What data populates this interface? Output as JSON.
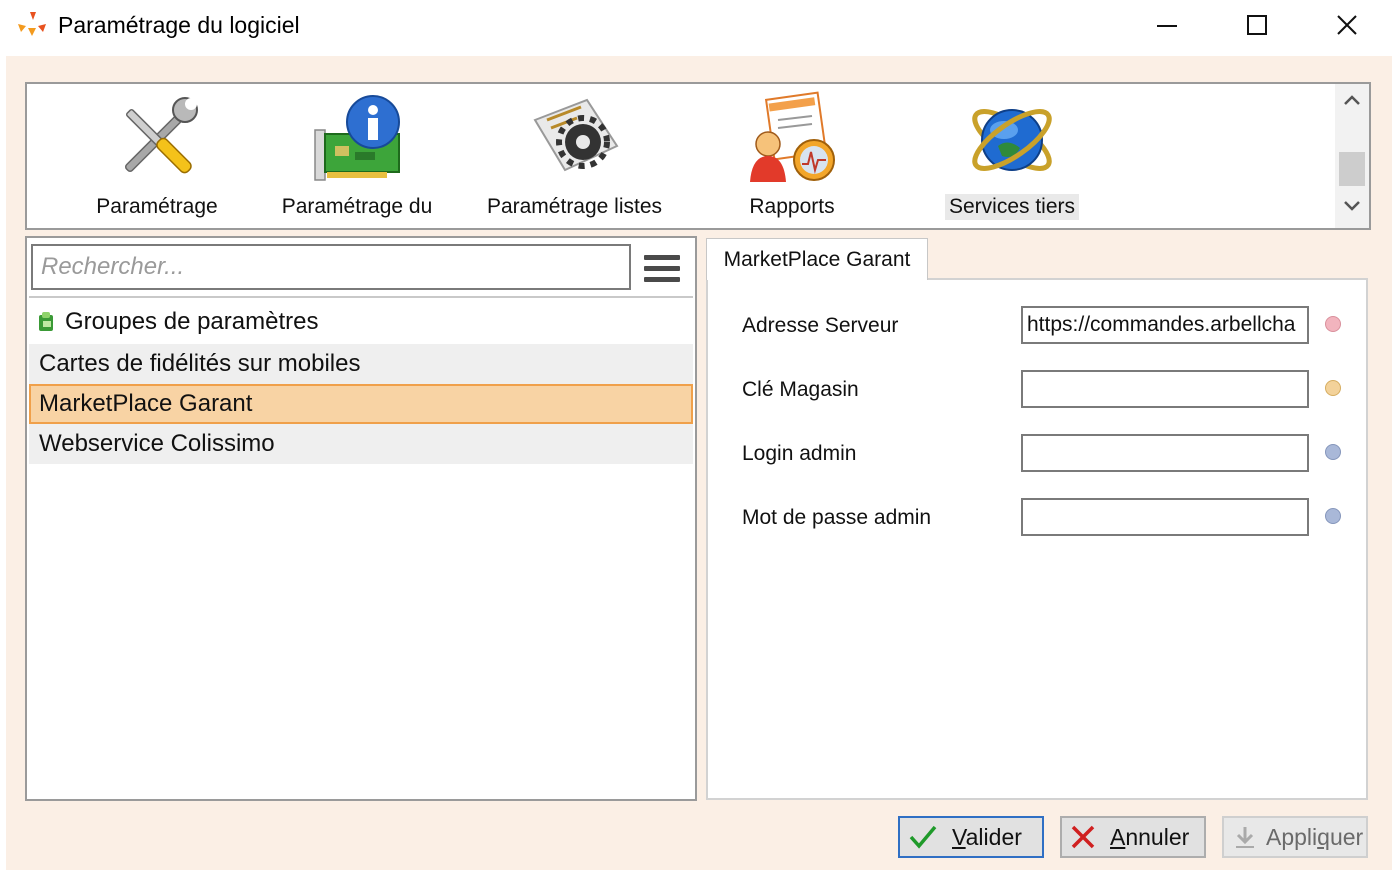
{
  "window": {
    "title": "Paramétrage du logiciel",
    "controls": {
      "minimize": "minimize-icon",
      "maximize": "maximize-icon",
      "close": "close-icon"
    }
  },
  "toolbar": {
    "items": [
      {
        "label": "Paramétrage",
        "icon": "tools-icon"
      },
      {
        "label": "Paramétrage du",
        "icon": "hardware-info-icon"
      },
      {
        "label": "Paramétrage listes",
        "icon": "list-settings-icon"
      },
      {
        "label": "Rapports",
        "icon": "reports-icon"
      },
      {
        "label": "Services tiers",
        "icon": "globe-services-icon",
        "active": true
      }
    ]
  },
  "left_panel": {
    "search": {
      "placeholder": "Rechercher...",
      "value": ""
    },
    "group_header": "Groupes de paramètres",
    "items": [
      {
        "label": "Cartes de fidélités sur mobiles"
      },
      {
        "label": "MarketPlace Garant",
        "selected": true
      },
      {
        "label": "Webservice Colissimo"
      }
    ]
  },
  "right_panel": {
    "tab": "MarketPlace Garant",
    "fields": [
      {
        "label": "Adresse Serveur",
        "value": "https://commandes.arbellcha",
        "status_color": "#f2b4be"
      },
      {
        "label": "Clé Magasin",
        "value": "",
        "status_color": "#f3d29a"
      },
      {
        "label": "Login admin",
        "value": "",
        "status_color": "#a9b8d8"
      },
      {
        "label": "Mot de passe admin",
        "value": "",
        "status_color": "#a9b8d8"
      }
    ]
  },
  "buttons": {
    "validate": {
      "mnemonic": "V",
      "rest": "alider"
    },
    "cancel": {
      "mnemonic": "A",
      "rest": "nnuler"
    },
    "apply": {
      "before": "Appli",
      "mnemonic": "q",
      "after": "uer"
    }
  },
  "colors": {
    "client_bg": "#fbefe5",
    "selection_bg": "#f8d3a4",
    "selection_border": "#f0a04a",
    "validate_border": "#2f6fc4"
  }
}
